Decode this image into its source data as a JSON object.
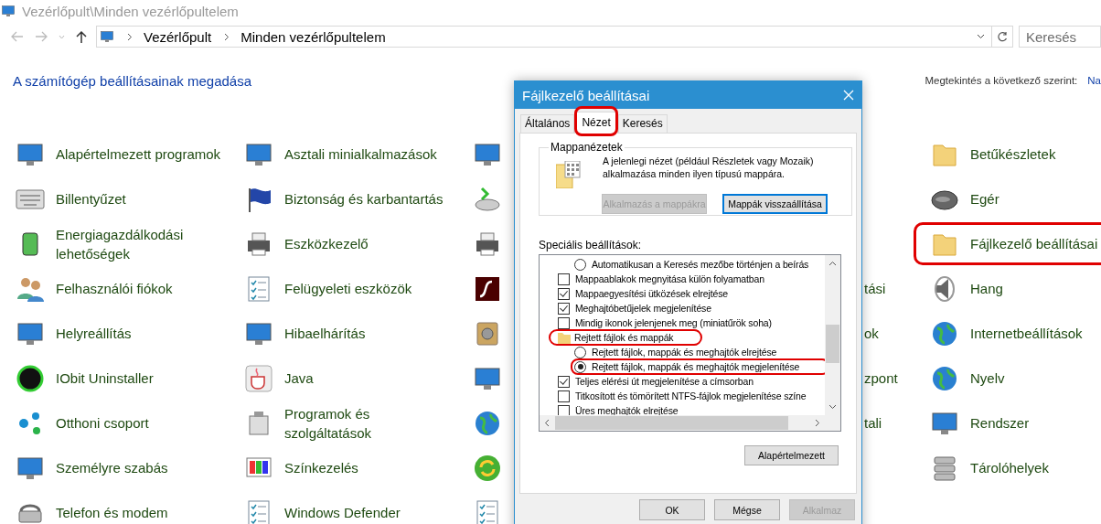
{
  "window": {
    "title": "Vezérlőpult\\Minden vezérlőpultelem"
  },
  "address_bar": {
    "breadcrumbs": [
      "Vezérlőpult",
      "Minden vezérlőpultelem"
    ]
  },
  "search": {
    "placeholder": "Keresés"
  },
  "header": {
    "link": "A számítógép beállításainak megadása",
    "view_label": "Megtekintés a következő szerint:",
    "view_value": "Na"
  },
  "columns": [
    {
      "items": [
        {
          "kind": "full",
          "label": "Alapértelmezett programok",
          "highlighted": false
        },
        {
          "kind": "full",
          "label": "Billentyűzet",
          "highlighted": false
        },
        {
          "kind": "full",
          "label": "Energiagazdálkodási lehetőségek",
          "highlighted": false
        },
        {
          "kind": "full",
          "label": "Felhasználói fiókok",
          "highlighted": false
        },
        {
          "kind": "full",
          "label": "Helyreállítás",
          "highlighted": false
        },
        {
          "kind": "full",
          "label": "IObit Uninstaller",
          "highlighted": false
        },
        {
          "kind": "full",
          "label": "Otthoni csoport",
          "highlighted": false
        },
        {
          "kind": "full",
          "label": "Személyre szabás",
          "highlighted": false
        },
        {
          "kind": "full",
          "label": "Telefon és modem",
          "highlighted": false
        }
      ]
    },
    {
      "items": [
        {
          "kind": "full",
          "label": "Asztali minialkalmazások",
          "highlighted": false
        },
        {
          "kind": "full",
          "label": "Biztonság és karbantartás",
          "highlighted": false
        },
        {
          "kind": "full",
          "label": "Eszközkezelő",
          "highlighted": false
        },
        {
          "kind": "full",
          "label": "Felügyeleti eszközök",
          "highlighted": false
        },
        {
          "kind": "full",
          "label": "Hibaelhárítás",
          "highlighted": false
        },
        {
          "kind": "full",
          "label": "Java",
          "highlighted": false
        },
        {
          "kind": "full",
          "label": "Programok és szolgáltatások",
          "highlighted": false
        },
        {
          "kind": "full",
          "label": "Színkezelés",
          "highlighted": false
        },
        {
          "kind": "full",
          "label": "Windows Defender",
          "highlighted": false
        }
      ]
    },
    {
      "items": [
        {
          "kind": "icon_only"
        },
        {
          "kind": "icon_only"
        },
        {
          "kind": "icon_only"
        },
        {
          "kind": "icon_only"
        },
        {
          "kind": "icon_only"
        },
        {
          "kind": "icon_only"
        },
        {
          "kind": "icon_only"
        },
        {
          "kind": "icon_only"
        },
        {
          "kind": "icon_only"
        }
      ]
    },
    {
      "items": [
        {
          "kind": "covered"
        },
        {
          "kind": "covered"
        },
        {
          "kind": "covered"
        },
        {
          "kind": "tail",
          "label": "tási"
        },
        {
          "kind": "tail",
          "label": "ok"
        },
        {
          "kind": "tail",
          "label": "zpont"
        },
        {
          "kind": "tail",
          "label": "tali"
        },
        {
          "kind": "covered"
        },
        {
          "kind": "covered"
        }
      ]
    },
    {
      "items": [
        {
          "kind": "full",
          "label": "Betűkészletek",
          "highlighted": false
        },
        {
          "kind": "full",
          "label": "Egér",
          "highlighted": false
        },
        {
          "kind": "full",
          "label": "Fájlkezelő beállításai",
          "highlighted": true
        },
        {
          "kind": "full",
          "label": "Hang",
          "highlighted": false
        },
        {
          "kind": "full",
          "label": "Internetbeállítások",
          "highlighted": false
        },
        {
          "kind": "full",
          "label": "Nyelv",
          "highlighted": false
        },
        {
          "kind": "full",
          "label": "Rendszer",
          "highlighted": false
        },
        {
          "kind": "full",
          "label": "Tárolóhelyek",
          "highlighted": false
        }
      ]
    }
  ],
  "dialog": {
    "title": "Fájlkezelő beállításai",
    "tabs": [
      {
        "label": "Általános",
        "selected": false,
        "highlighted": false
      },
      {
        "label": "Nézet",
        "selected": true,
        "highlighted": true
      },
      {
        "label": "Keresés",
        "selected": false,
        "highlighted": false
      }
    ],
    "folder_views": {
      "title": "Mappanézetek",
      "description": "A jelenlegi nézet (például Részletek vagy Mozaik) alkalmazása minden ilyen típusú mappára.",
      "buttons": [
        {
          "label": "Alkalmazás a mappákra",
          "disabled": true,
          "focused": false
        },
        {
          "label": "Mappák visszaállítása",
          "disabled": false,
          "focused": true
        }
      ]
    },
    "advanced": {
      "title": "Speciális beállítások:",
      "items": [
        {
          "kind": "group",
          "children": [
            {
              "kind": "radio",
              "label": "Automatikusan a Keresés mezőbe történjen a beírás",
              "selected": false,
              "highlighted": false
            }
          ]
        },
        {
          "kind": "checkbox",
          "label": "Mappaablakok megnyitása külön folyamatban",
          "checked": false,
          "highlighted": false
        },
        {
          "kind": "checkbox",
          "label": "Mappaegyesítési ütközések elrejtése",
          "checked": true,
          "highlighted": false
        },
        {
          "kind": "checkbox",
          "label": "Meghajtóbetűjelek megjelenítése",
          "checked": true,
          "highlighted": false
        },
        {
          "kind": "checkbox",
          "label": "Mindig ikonok jelenjenek meg (miniatűrök soha)",
          "checked": false,
          "highlighted": false
        },
        {
          "kind": "folder",
          "label": "Rejtett fájlok és mappák",
          "highlighted": true,
          "children": [
            {
              "kind": "radio",
              "label": "Rejtett fájlok, mappák és meghajtók elrejtése",
              "selected": false,
              "highlighted": false
            },
            {
              "kind": "radio",
              "label": "Rejtett fájlok, mappák és meghajtók megjelenítése",
              "selected": true,
              "highlighted": true
            }
          ]
        },
        {
          "kind": "checkbox",
          "label": "Teljes elérési út megjelenítése a címsorban",
          "checked": true,
          "highlighted": false
        },
        {
          "kind": "checkbox",
          "label": "Titkosított és tömörített NTFS-fájlok megjelenítése színe",
          "checked": false,
          "highlighted": false
        },
        {
          "kind": "checkbox",
          "label": "Üres meghajtók elrejtése",
          "checked": false,
          "highlighted": false
        }
      ]
    },
    "restore_button": "Alapértelmezett",
    "buttons": [
      {
        "label": "OK",
        "disabled": false
      },
      {
        "label": "Mégse",
        "disabled": false
      },
      {
        "label": "Alkalmaz",
        "disabled": true
      }
    ]
  }
}
